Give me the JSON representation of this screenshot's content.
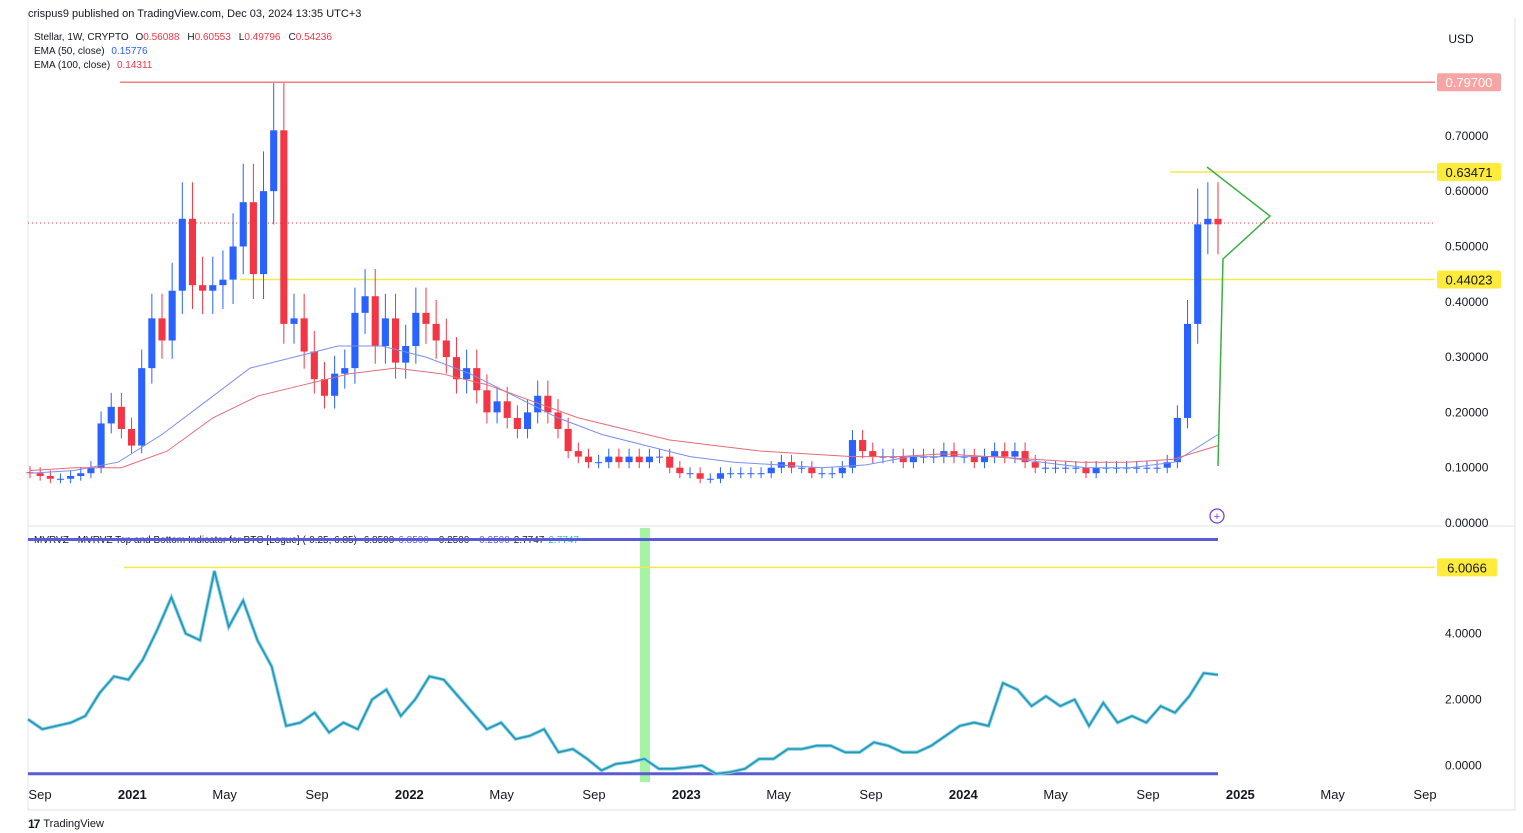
{
  "header": {
    "published": "crispus9 published on TradingView.com, Dec 03, 2024 13:35 UTC+3"
  },
  "legend": {
    "symbol": "Stellar, 1W, CRYPTO",
    "ohlc": [
      {
        "k": "O",
        "v": "0.56088"
      },
      {
        "k": "H",
        "v": "0.60553"
      },
      {
        "k": "L",
        "v": "0.49796"
      },
      {
        "k": "C",
        "v": "0.54236"
      }
    ],
    "ema50": {
      "label": "EMA (50, close)",
      "value": "0.15776",
      "color": "#2962ff"
    },
    "ema100": {
      "label": "EMA (100, close)",
      "value": "0.14311",
      "color": "#f23645"
    }
  },
  "currency": "USD",
  "indicator_legend": {
    "label": "MVRVZ - MVRVZ Top and Bottom Indicator for BTC [Logue] (-0.25, 6.85)",
    "values": [
      {
        "plain": "6.8500",
        "colored": "6.8500",
        "color": "#5b5bd6"
      },
      {
        "plain": "−0.2500",
        "colored": "−0.2500",
        "color": "#5b5bd6"
      },
      {
        "plain": "2.7747",
        "colored": "2.7747",
        "color": "#22c5cf"
      }
    ]
  },
  "footer": {
    "brand": "TradingView",
    "logo": "17"
  },
  "chart_data": [
    {
      "type": "candlestick",
      "title": "Stellar, 1W, CRYPTO",
      "ylim": [
        0,
        0.81
      ],
      "y_ticks": [
        "0.00000",
        "0.10000",
        "0.20000",
        "0.30000",
        "0.40000",
        "0.50000",
        "0.60000",
        "0.70000"
      ],
      "x_ticks": [
        "Sep",
        "2021",
        "May",
        "Sep",
        "2022",
        "May",
        "Sep",
        "2023",
        "May",
        "Sep",
        "2024",
        "May",
        "Sep",
        "2025",
        "May",
        "Sep"
      ],
      "x_ticks_bold": [
        false,
        true,
        false,
        false,
        true,
        false,
        false,
        true,
        false,
        false,
        true,
        false,
        false,
        true,
        false,
        false
      ],
      "horizontal_levels": [
        {
          "value": 0.797,
          "label": "0.79700",
          "color": "#f7a4a4"
        },
        {
          "value": 0.63471,
          "label": "0.63471",
          "color": "#ffeb3b"
        },
        {
          "value": 0.44023,
          "label": "0.44023",
          "color": "#ffeb3b"
        }
      ],
      "last_price": 0.54236,
      "close_series_approx": [
        0.09,
        0.085,
        0.08,
        0.08,
        0.085,
        0.09,
        0.1,
        0.18,
        0.21,
        0.17,
        0.14,
        0.28,
        0.37,
        0.33,
        0.42,
        0.55,
        0.43,
        0.42,
        0.43,
        0.44,
        0.5,
        0.58,
        0.45,
        0.6,
        0.71,
        0.36,
        0.37,
        0.31,
        0.26,
        0.23,
        0.27,
        0.28,
        0.38,
        0.41,
        0.32,
        0.37,
        0.29,
        0.32,
        0.38,
        0.36,
        0.33,
        0.3,
        0.26,
        0.28,
        0.24,
        0.2,
        0.22,
        0.19,
        0.17,
        0.2,
        0.23,
        0.2,
        0.17,
        0.13,
        0.12,
        0.11,
        0.11,
        0.12,
        0.11,
        0.12,
        0.11,
        0.12,
        0.12,
        0.1,
        0.09,
        0.09,
        0.08,
        0.08,
        0.09,
        0.09,
        0.09,
        0.09,
        0.09,
        0.1,
        0.11,
        0.1,
        0.1,
        0.09,
        0.09,
        0.09,
        0.1,
        0.15,
        0.13,
        0.12,
        0.12,
        0.12,
        0.11,
        0.12,
        0.12,
        0.12,
        0.13,
        0.12,
        0.12,
        0.11,
        0.12,
        0.13,
        0.12,
        0.13,
        0.11,
        0.1,
        0.1,
        0.1,
        0.1,
        0.1,
        0.09,
        0.1,
        0.1,
        0.1,
        0.1,
        0.1,
        0.1,
        0.1,
        0.11,
        0.19,
        0.36,
        0.54,
        0.55,
        0.54
      ],
      "ema50_approx": [
        0.09,
        0.095,
        0.11,
        0.16,
        0.22,
        0.28,
        0.3,
        0.32,
        0.32,
        0.3,
        0.27,
        0.23,
        0.19,
        0.16,
        0.14,
        0.12,
        0.11,
        0.105,
        0.1,
        0.105,
        0.12,
        0.12,
        0.12,
        0.11,
        0.1,
        0.1,
        0.11,
        0.16
      ],
      "ema100_approx": [
        0.095,
        0.1,
        0.1,
        0.13,
        0.19,
        0.23,
        0.25,
        0.27,
        0.28,
        0.27,
        0.25,
        0.22,
        0.19,
        0.17,
        0.15,
        0.14,
        0.13,
        0.125,
        0.12,
        0.12,
        0.125,
        0.12,
        0.115,
        0.11,
        0.11,
        0.115,
        0.14
      ]
    },
    {
      "type": "line",
      "title": "MVRVZ - MVRVZ Top and Bottom Indicator for BTC [Logue] (-0.25, 6.85)",
      "ylim": [
        -0.5,
        7.2
      ],
      "y_ticks": [
        "0.0000",
        "2.0000",
        "4.0000"
      ],
      "horizontal_levels": [
        {
          "value": 6.85,
          "color": "#5b5bd6"
        },
        {
          "value": -0.25,
          "color": "#5b5bd6"
        },
        {
          "value": 6.0066,
          "label": "6.0066",
          "color": "#ffeb3b"
        }
      ],
      "highlight": {
        "label": "bottom zone",
        "color": "#8ef08e"
      },
      "series": [
        {
          "color": "#2a93b3",
          "values": [
            1.4,
            1.1,
            1.2,
            1.3,
            1.5,
            2.2,
            2.7,
            2.6,
            3.2,
            4.1,
            5.1,
            4.0,
            3.8,
            5.9,
            4.2,
            5.0,
            3.8,
            3.0,
            1.2,
            1.3,
            1.6,
            1.0,
            1.3,
            1.1,
            2.0,
            2.3,
            1.5,
            2.0,
            2.7,
            2.6,
            2.1,
            1.6,
            1.1,
            1.3,
            0.8,
            0.9,
            1.1,
            0.4,
            0.5,
            0.2,
            -0.15,
            0.05,
            0.1,
            0.2,
            -0.1,
            -0.1,
            -0.05,
            0.0,
            -0.25,
            -0.2,
            -0.1,
            0.2,
            0.2,
            0.5,
            0.5,
            0.6,
            0.6,
            0.4,
            0.4,
            0.7,
            0.6,
            0.4,
            0.4,
            0.6,
            0.9,
            1.2,
            1.3,
            1.2,
            2.5,
            2.3,
            1.8,
            2.1,
            1.8,
            2.0,
            1.2,
            1.9,
            1.3,
            1.5,
            1.3,
            1.8,
            1.6,
            2.1,
            2.8,
            2.75
          ]
        }
      ]
    }
  ]
}
